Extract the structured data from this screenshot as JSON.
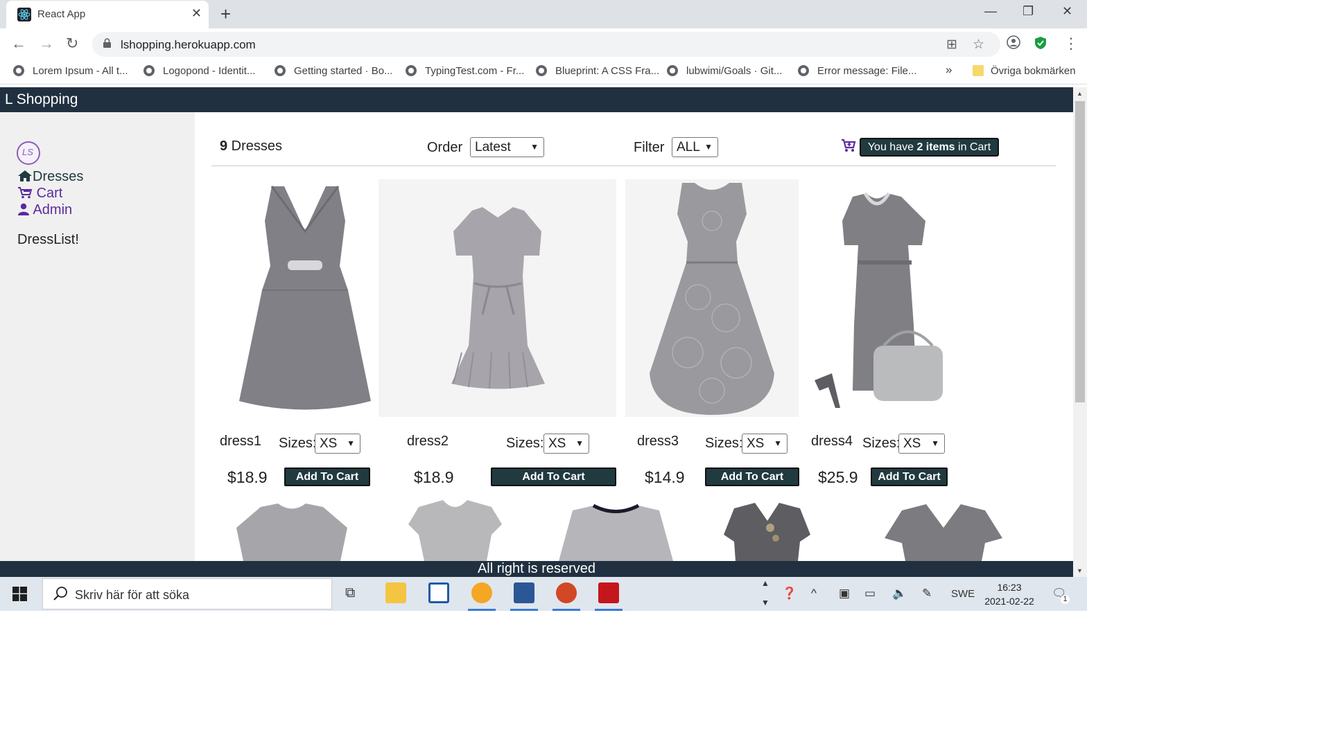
{
  "browser": {
    "tab_title": "React App",
    "tab_close": "✕",
    "new_tab": "+",
    "url": "lshopping.herokuapp.com",
    "bookmarks": [
      "Lorem Ipsum - All t...",
      "Logopond - Identit...",
      "Getting started · Bo...",
      "TypingTest.com - Fr...",
      "Blueprint: A CSS Fra...",
      "lubwimi/Goals · Git...",
      "Error message: File..."
    ],
    "bookmarks_overflow": "»",
    "other_bookmarks": "Övriga bokmärken"
  },
  "app": {
    "brand": "L Shopping",
    "logo_text": "LS",
    "nav": {
      "dresses": "Dresses",
      "cart": "Cart",
      "admin": "Admin"
    },
    "dresslist": "DressList!",
    "count_number": "9",
    "count_label": " Dresses",
    "order_label": "Order",
    "order_value": "Latest",
    "filter_label": "Filter",
    "filter_value": "ALL",
    "cart_text_pre": "You have ",
    "cart_text_bold": "2 items",
    "cart_text_post": " in Cart",
    "products": [
      {
        "name": "dress1",
        "sizes_label": "Sizes:",
        "size": "XS",
        "price": "$18.9",
        "button": "Add To Cart"
      },
      {
        "name": "dress2",
        "sizes_label": "Sizes:",
        "size": "XS",
        "price": "$18.9",
        "button": "Add To Cart"
      },
      {
        "name": "dress3",
        "sizes_label": "Sizes:",
        "size": "XS",
        "price": "$14.9",
        "button": "Add To Cart"
      },
      {
        "name": "dress4",
        "sizes_label": "Sizes:",
        "size": "XS",
        "price": "$25.9",
        "button": "Add To Cart"
      }
    ],
    "footer": "All right is reserved"
  },
  "taskbar": {
    "search_placeholder": "Skriv här för att söka",
    "language": "SWE",
    "time": "16:23",
    "date": "2021-02-22",
    "notification_count": "1"
  },
  "colors": {
    "header": "#203040",
    "button": "#203a40",
    "nav_link": "#5b2aa0",
    "dress_gray": "#808086"
  }
}
